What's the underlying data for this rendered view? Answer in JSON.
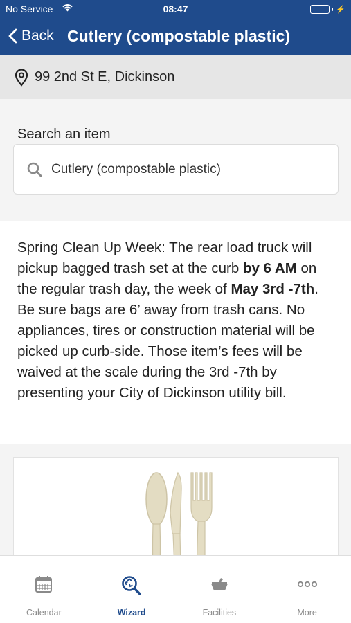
{
  "status_bar": {
    "carrier": "No Service",
    "time": "08:47",
    "battery_level": 1.0
  },
  "nav": {
    "back_label": "Back",
    "title": "Cutlery (compostable plastic)"
  },
  "address": {
    "icon": "location-pin-icon",
    "text": "99 2nd St E, Dickinson"
  },
  "search": {
    "label": "Search an item",
    "value": "Cutlery (compostable plastic)",
    "icon": "search-icon"
  },
  "info": {
    "part1": "Spring Clean Up Week: The rear load truck will pickup bagged trash set at the curb ",
    "bold1": "by 6 AM",
    "part2": " on the regular trash day, the week of ",
    "bold2": "May 3rd -7th",
    "part3": ". Be sure bags are 6’ away from trash cans. No appliances, tires or construction material will be picked up curb-side. Those item’s fees will be waived at the scale during the 3rd -7th by presenting your City of Dickinson utility bill."
  },
  "tabs": [
    {
      "label": "Calendar",
      "icon": "calendar-icon",
      "active": false
    },
    {
      "label": "Wizard",
      "icon": "wizard-recycle-search-icon",
      "active": true
    },
    {
      "label": "Facilities",
      "icon": "facilities-bin-icon",
      "active": false
    },
    {
      "label": "More",
      "icon": "more-dots-icon",
      "active": false
    }
  ],
  "colors": {
    "header_blue": "#1f4b8c",
    "battery_green": "#4cd964",
    "inactive_tab": "#8a8a8a"
  }
}
